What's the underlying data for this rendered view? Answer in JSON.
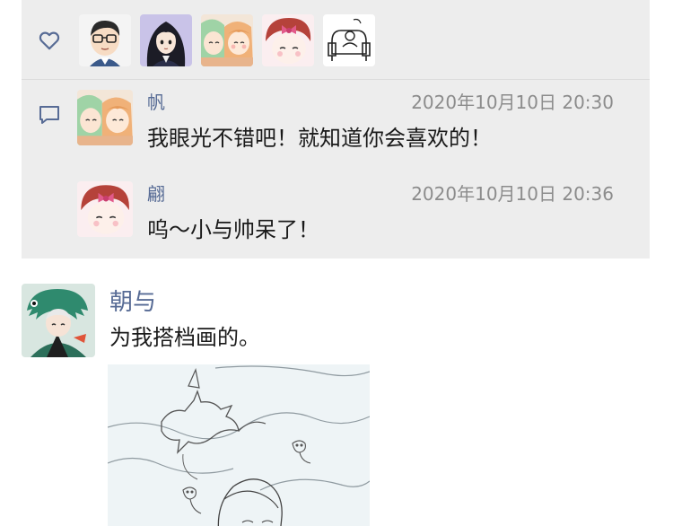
{
  "likes": {
    "icon": "heart-icon",
    "avatars": [
      "glasses-boy-avatar",
      "long-hair-girl-avatar",
      "anime-pair-avatar",
      "bow-girl-avatar",
      "armchair-sketch-avatar"
    ]
  },
  "comments": [
    {
      "name": "帆",
      "time": "2020年10月10日 20:30",
      "text": "我眼光不错吧！就知道你会喜欢的！",
      "avatar": "anime-pair-avatar"
    },
    {
      "name": "翩",
      "time": "2020年10月10日 20:36",
      "text": "呜～小与帅呆了！",
      "avatar": "bow-girl-avatar"
    }
  ],
  "post": {
    "author": "朝与",
    "text": "为我搭档画的。",
    "avatar": "dinosaur-hood-avatar",
    "image": "dragon-sketch-image"
  },
  "colors": {
    "panel": "#ededed",
    "name": "#576b95",
    "time": "#8c8c8c",
    "text": "#1a1a1a",
    "icon": "#576b95"
  }
}
